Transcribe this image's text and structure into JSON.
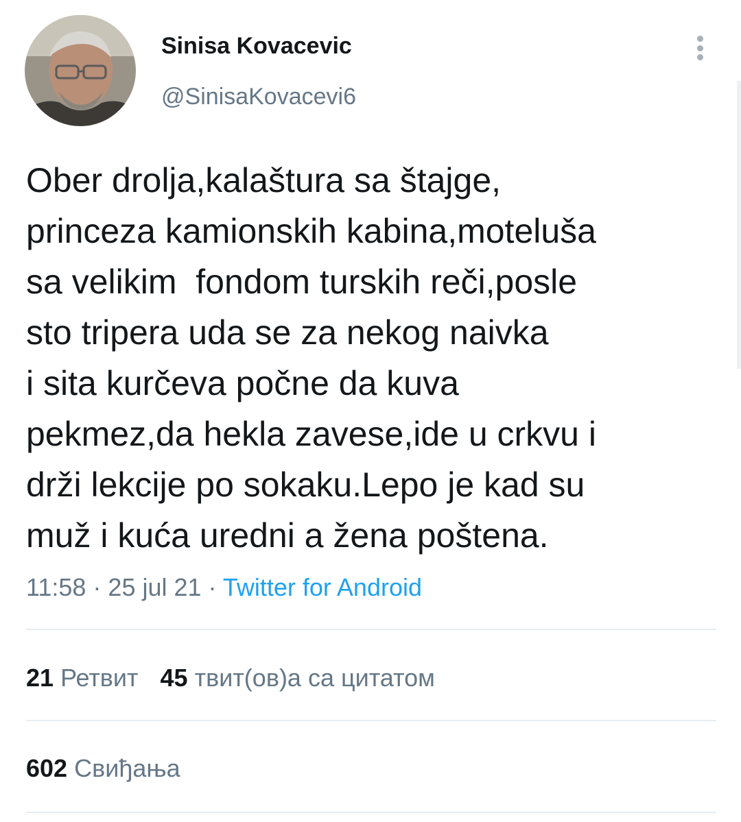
{
  "tweet": {
    "author": {
      "display_name": "Sinisa Kovacevic",
      "handle": "@SinisaKovacevi6"
    },
    "text": "Ober drolja,kalaštura sa štajge,\nprinceza kamionskih kabina,moteluša\nsa velikim  fondom turskih reči,posle\nsto tripera uda se za nekog naivka\ni sita kurčeva počne da kuva\npekmez,da hekla zavese,ide u crkvu i\ndrži lekcije po sokaku.Lepo je kad su\nmuž i kuća uredni a žena poštena.",
    "time": "11:58",
    "date": "25 jul 21",
    "separator": " · ",
    "source": "Twitter for Android"
  },
  "stats": {
    "retweets_count": "21",
    "retweets_label": "Ретвит",
    "quotes_count": "45",
    "quotes_label": "твит(ов)а са цитатом",
    "likes_count": "602",
    "likes_label": "Свиђања"
  },
  "icons": {
    "more": "more-vertical-icon"
  },
  "colors": {
    "primary_text": "#14171a",
    "secondary_text": "#657786",
    "link": "#1da1f2",
    "divider": "#e6ecf0"
  }
}
